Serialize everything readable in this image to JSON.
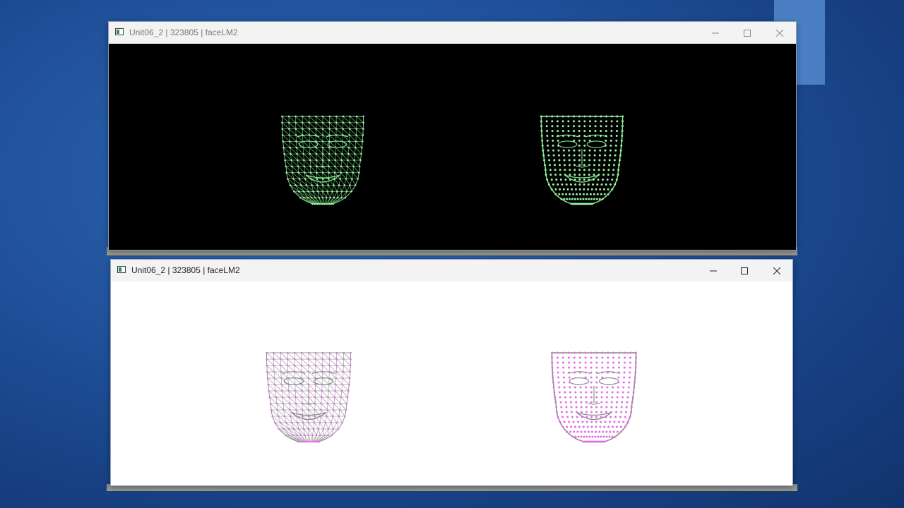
{
  "window_top": {
    "title": "Unit06_2 | 323805 | faceLM2",
    "background": "#000000",
    "mesh_color": "#7fe28a",
    "point_color": "#9bf0a2",
    "panels": [
      {
        "style": "triangulated-mesh"
      },
      {
        "style": "landmark-points-contour"
      }
    ]
  },
  "window_bottom": {
    "title": "Unit06_2 | 323805 | faceLM2",
    "background": "#ffffff",
    "mesh_color": "#8a8a8a",
    "point_color": "#e070e6",
    "panels": [
      {
        "style": "triangulated-mesh"
      },
      {
        "style": "landmark-points-contour"
      }
    ]
  },
  "controls": {
    "minimize_icon": "minimize-icon",
    "maximize_icon": "maximize-icon",
    "close_icon": "close-icon"
  }
}
